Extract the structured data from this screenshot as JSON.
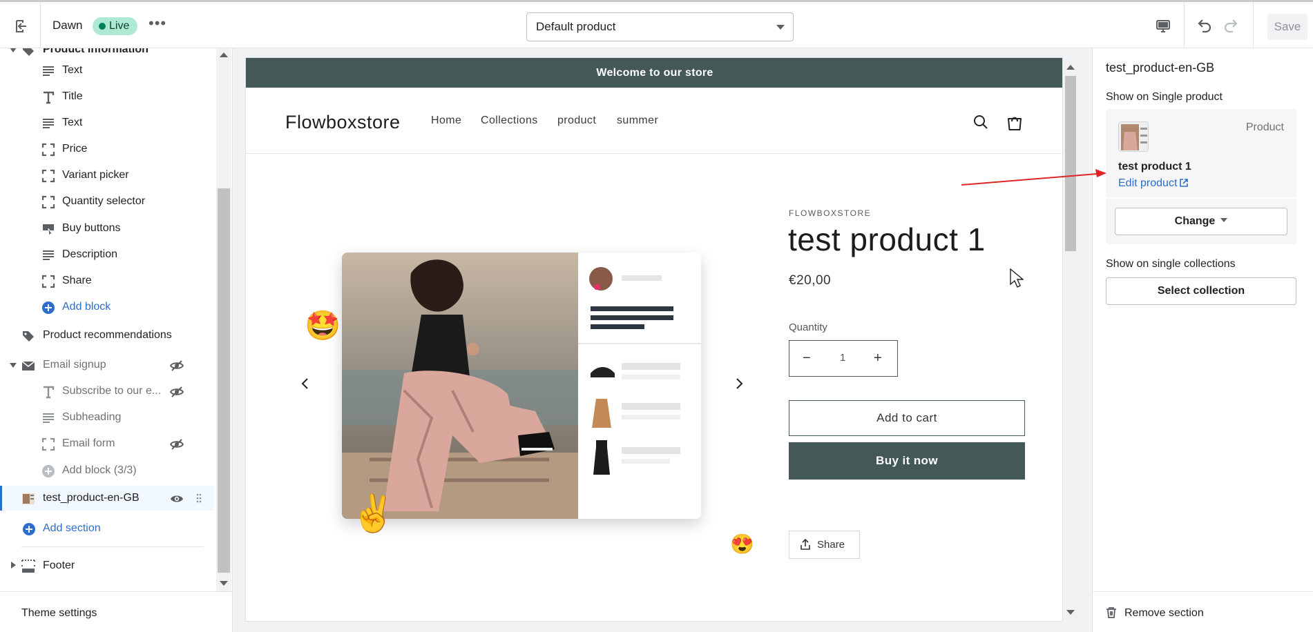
{
  "topbar": {
    "theme_name": "Dawn",
    "live_badge": "Live",
    "more_label": "•••",
    "template_select": "Default product",
    "save_label": "Save"
  },
  "sidebar": {
    "items": [
      {
        "label": "Product information",
        "icon": "tag-icon",
        "kind": "section"
      },
      {
        "label": "Text",
        "icon": "text-lines-icon"
      },
      {
        "label": "Title",
        "icon": "title-t-icon"
      },
      {
        "label": "Text",
        "icon": "text-lines-icon"
      },
      {
        "label": "Price",
        "icon": "dashed-frame-icon"
      },
      {
        "label": "Variant picker",
        "icon": "dashed-frame-icon"
      },
      {
        "label": "Quantity selector",
        "icon": "dashed-frame-icon"
      },
      {
        "label": "Buy buttons",
        "icon": "cursor-click-icon"
      },
      {
        "label": "Description",
        "icon": "text-lines-icon"
      },
      {
        "label": "Share",
        "icon": "dashed-frame-icon"
      },
      {
        "label": "Add block",
        "icon": "plus-circle-icon"
      },
      {
        "label": "Product recommendations",
        "icon": "tag-icon"
      },
      {
        "label": "Email signup",
        "icon": "envelope-icon"
      },
      {
        "label": "Subscribe to our e...",
        "icon": "title-t-icon"
      },
      {
        "label": "Subheading",
        "icon": "text-lines-icon"
      },
      {
        "label": "Email form",
        "icon": "dashed-frame-icon"
      },
      {
        "label": "Add block (3/3)",
        "icon": "plus-circle-icon"
      },
      {
        "label": "test_product-en-GB",
        "icon": "product-thumbnail"
      },
      {
        "label": "Add section",
        "icon": "plus-circle-icon"
      },
      {
        "label": "Footer",
        "icon": "footer-frame-icon"
      }
    ],
    "theme_settings": "Theme settings"
  },
  "preview": {
    "announcement": "Welcome to our store",
    "store_name": "Flowboxstore",
    "nav": [
      "Home",
      "Collections",
      "product",
      "summer"
    ],
    "vendor": "FLOWBOXSTORE",
    "product_title": "test product 1",
    "price": "€20,00",
    "quantity_label": "Quantity",
    "quantity_value": "1",
    "add_to_cart": "Add to cart",
    "buy_now": "Buy it now",
    "share": "Share"
  },
  "right_panel": {
    "title": "test_product-en-GB",
    "show_on_single_product": "Show on Single product",
    "card_type": "Product",
    "product_name": "test product 1",
    "edit_product": "Edit product",
    "change_label": "Change",
    "show_on_single_collections": "Show on single collections",
    "select_collection": "Select collection",
    "remove_section": "Remove section"
  },
  "colors": {
    "accent_blue": "#2c6ecb",
    "store_dark": "#445858",
    "live_badge": "#aee9d1",
    "annotation_red": "#e02424"
  }
}
